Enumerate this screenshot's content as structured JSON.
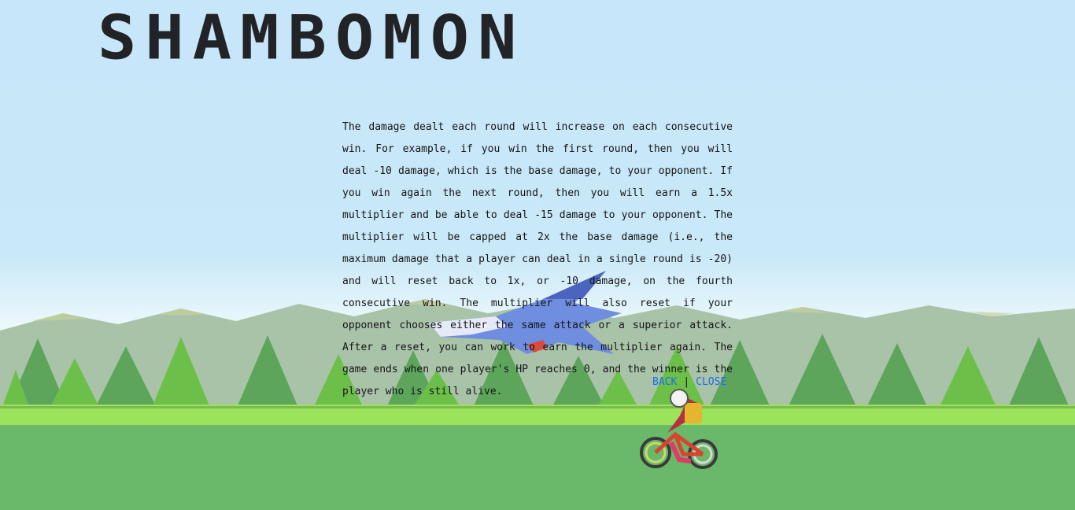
{
  "title": "SHAMBOMON",
  "rules_text": "The damage dealt each round will increase on each consecutive win. For example, if you win the first round, then you will deal -10 damage, which is the base damage, to your opponent. If you win again the next round, then you will earn a 1.5x multiplier and be able to deal -15 damage to your opponent. The multiplier will be capped at 2x the base damage (i.e., the maximum damage that a player can deal in a single round is -20) and will reset back to 1x, or -10 damage, on the fourth consecutive win. The multiplier will also reset if your opponent chooses either the same attack or a superior attack. After a reset, you can work to earn the multiplier again. The game ends when one player's HP reaches 0, and the winner is the player who is still alive.",
  "nav": {
    "back_label": "BACK",
    "separator": "|",
    "close_label": "CLOSE"
  },
  "colors": {
    "sky": "#c7e6f9",
    "mountains": "#a9c3a8",
    "trees_dark": "#5ea55c",
    "trees_light": "#6cc04a",
    "grass_top": "#9be35a",
    "grass": "#6ab86a",
    "link": "#1c6cf0",
    "title": "#222326"
  },
  "sprites": {
    "dragon": "latios-sprite",
    "rider": "bicycle-rider-sprite"
  }
}
